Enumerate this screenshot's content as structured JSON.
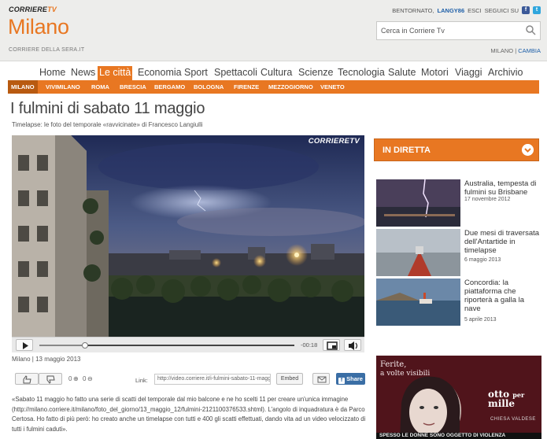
{
  "header": {
    "brand_corriere": "CORRIERE",
    "brand_tv": "TV",
    "city": "Milano",
    "site": "CORRIERE DELLA SERA.IT",
    "welcome": "BENTORNATO,",
    "username": "LANGY86",
    "logout": "ESCI",
    "follow": "SEGUICI SU",
    "facebook_glyph": "f",
    "twitter_glyph": "t",
    "search_placeholder": "Cerca in Corriere Tv",
    "location": "MILANO",
    "separator": "|",
    "change": "CAMBIA"
  },
  "main_nav": [
    "Home",
    "News",
    "Le città",
    "Economia",
    "Sport",
    "Spettacoli",
    "Cultura",
    "Scienze",
    "Tecnologia",
    "Salute",
    "Motori",
    "Viaggi",
    "Archivio"
  ],
  "main_nav_active": "Le città",
  "sub_nav": [
    "MILANO",
    "VIVIMILANO",
    "ROMA",
    "BRESCIA",
    "BERGAMO",
    "BOLOGNA",
    "FIRENZE",
    "MEZZOGIORNO",
    "VENETO"
  ],
  "sub_nav_active": "MILANO",
  "article": {
    "title": "I fulmini di sabato 11 maggio",
    "subtitle": "Timelapse: le foto del temporale «ravvicinate» di Francesco Langiulli",
    "meta": "Milano | 13 maggio 2013",
    "description": "«Sabato 11 maggio ho fatto una serie di scatti del temporale dal mio balcone e ne ho scelti 11 per creare un'unica immagine (http://milano.corriere.it/milano/foto_del_giorno/13_maggio_12/fulmini-2121100376533.shtml). L'angolo di inquadratura è da Parco Certosa. Ho fatto di più però: ho creato anche un timelapse con tutti e 400 gli scatti effettuati, dando vita ad un video velocizzato di tutti i fulmini caduti»."
  },
  "player": {
    "logo": "CORRIERETV",
    "time": "-00:18",
    "progress": 0.18
  },
  "tools": {
    "likes": "0",
    "dislikes": "0",
    "link_label": "Link:",
    "link_value": "http://video.corriere.it/i-fulmini-sabato-11-maggio",
    "embed": "Embed",
    "share": "Share"
  },
  "sidebar": {
    "diretta": "IN DIRETTA",
    "related": [
      {
        "title": "Australia, tempesta di fulmini su Brisbane",
        "date": "17 novembre 2012"
      },
      {
        "title": "Due mesi di traversata dell'Antartide in timelapse",
        "date": "6 maggio 2013"
      },
      {
        "title": "Concordia: la piattaforma che riporterà a galla la nave",
        "date": "5 aprile 2013"
      }
    ]
  },
  "ad": {
    "line1": "Ferite,",
    "line2": "a volte visibili",
    "otto": "otto",
    "per": "per",
    "mille": "mille",
    "mille_sub": "CHIESA VALDESE",
    "bottom": "SPESSO LE DONNE SONO OGGETTO DI VIOLENZA"
  },
  "colors": {
    "accent": "#e87722",
    "link": "#1e5fa8",
    "share": "#3a6ea5"
  }
}
